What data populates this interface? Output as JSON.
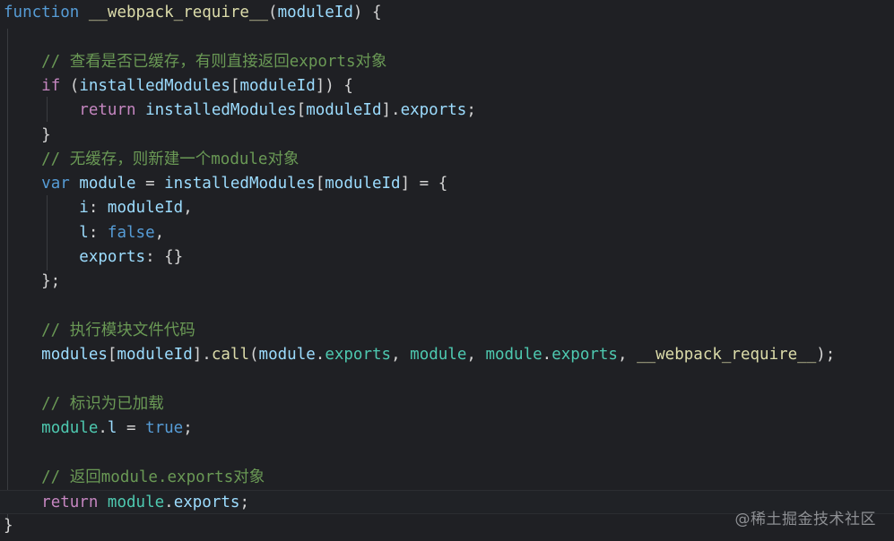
{
  "code_lines": [
    [
      {
        "t": "function",
        "c": "kwb"
      },
      {
        "t": " ",
        "c": "pl"
      },
      {
        "t": "__webpack_require__",
        "c": "fn"
      },
      {
        "t": "(",
        "c": "pl"
      },
      {
        "t": "moduleId",
        "c": "var"
      },
      {
        "t": ") {",
        "c": "pl"
      }
    ],
    [],
    [
      {
        "t": "    // 查看是否已缓存，有则直接返回exports对象",
        "c": "cm"
      }
    ],
    [
      {
        "t": "    ",
        "c": "pl"
      },
      {
        "t": "if",
        "c": "kw"
      },
      {
        "t": " (",
        "c": "pl"
      },
      {
        "t": "installedModules",
        "c": "var"
      },
      {
        "t": "[",
        "c": "pl"
      },
      {
        "t": "moduleId",
        "c": "var"
      },
      {
        "t": "]) {",
        "c": "pl"
      }
    ],
    [
      {
        "t": "        ",
        "c": "pl"
      },
      {
        "t": "return",
        "c": "kw"
      },
      {
        "t": " ",
        "c": "pl"
      },
      {
        "t": "installedModules",
        "c": "var"
      },
      {
        "t": "[",
        "c": "pl"
      },
      {
        "t": "moduleId",
        "c": "var"
      },
      {
        "t": "].",
        "c": "pl"
      },
      {
        "t": "exports",
        "c": "var"
      },
      {
        "t": ";",
        "c": "pl"
      }
    ],
    [
      {
        "t": "    }",
        "c": "pl"
      }
    ],
    [
      {
        "t": "    // 无缓存，则新建一个module对象",
        "c": "cm"
      }
    ],
    [
      {
        "t": "    ",
        "c": "pl"
      },
      {
        "t": "var",
        "c": "kwb"
      },
      {
        "t": " ",
        "c": "pl"
      },
      {
        "t": "module",
        "c": "var"
      },
      {
        "t": " = ",
        "c": "pl"
      },
      {
        "t": "installedModules",
        "c": "var"
      },
      {
        "t": "[",
        "c": "pl"
      },
      {
        "t": "moduleId",
        "c": "var"
      },
      {
        "t": "] = {",
        "c": "pl"
      }
    ],
    [
      {
        "t": "        ",
        "c": "pl"
      },
      {
        "t": "i",
        "c": "var"
      },
      {
        "t": ": ",
        "c": "pl"
      },
      {
        "t": "moduleId",
        "c": "var"
      },
      {
        "t": ",",
        "c": "pl"
      }
    ],
    [
      {
        "t": "        ",
        "c": "pl"
      },
      {
        "t": "l",
        "c": "var"
      },
      {
        "t": ": ",
        "c": "pl"
      },
      {
        "t": "false",
        "c": "kwb"
      },
      {
        "t": ",",
        "c": "pl"
      }
    ],
    [
      {
        "t": "        ",
        "c": "pl"
      },
      {
        "t": "exports",
        "c": "var"
      },
      {
        "t": ": {}",
        "c": "pl"
      }
    ],
    [
      {
        "t": "    };",
        "c": "pl"
      }
    ],
    [],
    [
      {
        "t": "    // 执行模块文件代码",
        "c": "cm"
      }
    ],
    [
      {
        "t": "    ",
        "c": "pl"
      },
      {
        "t": "modules",
        "c": "var"
      },
      {
        "t": "[",
        "c": "pl"
      },
      {
        "t": "moduleId",
        "c": "var"
      },
      {
        "t": "].",
        "c": "pl"
      },
      {
        "t": "call",
        "c": "fn"
      },
      {
        "t": "(",
        "c": "pl"
      },
      {
        "t": "module",
        "c": "var"
      },
      {
        "t": ".",
        "c": "pl"
      },
      {
        "t": "exports",
        "c": "prop"
      },
      {
        "t": ", ",
        "c": "pl"
      },
      {
        "t": "module",
        "c": "prop"
      },
      {
        "t": ", ",
        "c": "pl"
      },
      {
        "t": "module",
        "c": "prop"
      },
      {
        "t": ".",
        "c": "pl"
      },
      {
        "t": "exports",
        "c": "prop"
      },
      {
        "t": ", ",
        "c": "pl"
      },
      {
        "t": "__webpack_require__",
        "c": "fn"
      },
      {
        "t": ");",
        "c": "pl"
      }
    ],
    [],
    [
      {
        "t": "    // 标识为已加载",
        "c": "cm"
      }
    ],
    [
      {
        "t": "    ",
        "c": "pl"
      },
      {
        "t": "module",
        "c": "prop"
      },
      {
        "t": ".",
        "c": "pl"
      },
      {
        "t": "l",
        "c": "var"
      },
      {
        "t": " = ",
        "c": "pl"
      },
      {
        "t": "true",
        "c": "kwb"
      },
      {
        "t": ";",
        "c": "pl"
      }
    ],
    [],
    [
      {
        "t": "    // 返回module.exports对象",
        "c": "cm"
      }
    ],
    [
      {
        "t": "    ",
        "c": "pl"
      },
      {
        "t": "return",
        "c": "kw"
      },
      {
        "t": " ",
        "c": "pl"
      },
      {
        "t": "module",
        "c": "prop"
      },
      {
        "t": ".",
        "c": "pl"
      },
      {
        "t": "exports",
        "c": "var"
      },
      {
        "t": ";",
        "c": "pl"
      }
    ],
    [
      {
        "t": "}",
        "c": "pl"
      }
    ]
  ],
  "current_line_index": 20,
  "watermark": "@稀土掘金技术社区",
  "colors": {
    "background": "#1f2024",
    "keyword": "#c586c0",
    "keyword_blue": "#569cd6",
    "function": "#dcdcaa",
    "variable": "#9cdcfe",
    "property": "#4ec9b0",
    "comment": "#6a9955"
  }
}
